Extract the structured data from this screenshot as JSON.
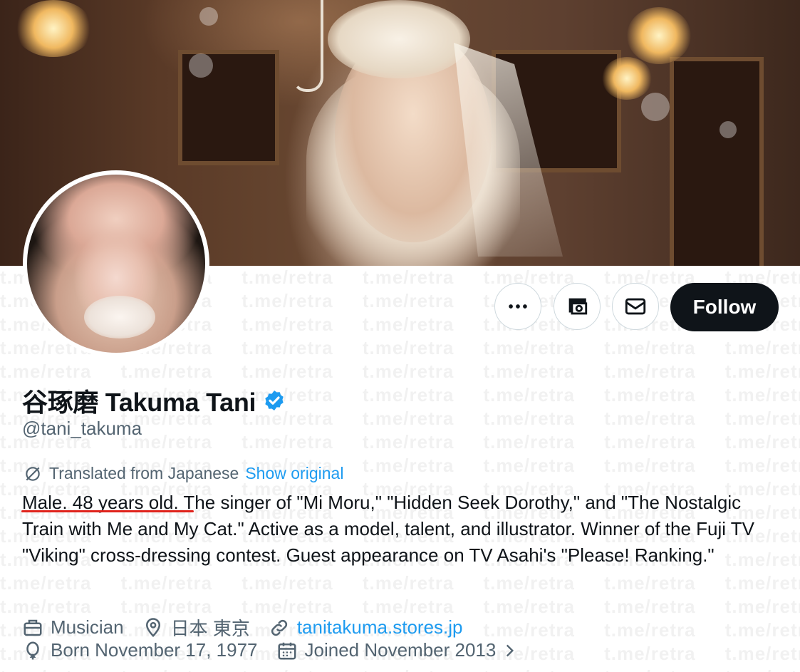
{
  "profile": {
    "display_name": "谷琢磨 Takuma Tani",
    "handle": "@tani_takuma",
    "verified": true,
    "translation_notice": "Translated from Japanese",
    "show_original_label": "Show original",
    "bio_highlight": "Male. 48 years old.",
    "bio_rest": " The singer of \"Mi Moru,\" \"Hidden Seek Dorothy,\" and \"The Nostalgic Train with Me and My Cat.\" Active as a model, talent, and illustrator. Winner of the Fuji TV \"Viking\" cross-dressing contest. Guest appearance on TV Asahi's \"Please! Ranking.\"",
    "category": "Musician",
    "location": "日本 東京",
    "website": "tanitakuma.stores.jp",
    "birthday": "Born November 17, 1977",
    "joined": "Joined November 2013"
  },
  "actions": {
    "more_icon": "more-horizontal-icon",
    "subscribe_icon": "subscribe-money-icon",
    "message_icon": "envelope-icon",
    "follow_label": "Follow"
  },
  "watermark": {
    "text": "t.me/retra"
  },
  "colors": {
    "accent": "#1d9bf0",
    "text_primary": "#0f1419",
    "text_secondary": "#536471",
    "underline_annotation": "#e0231c",
    "follow_button_bg": "#0f1419"
  }
}
